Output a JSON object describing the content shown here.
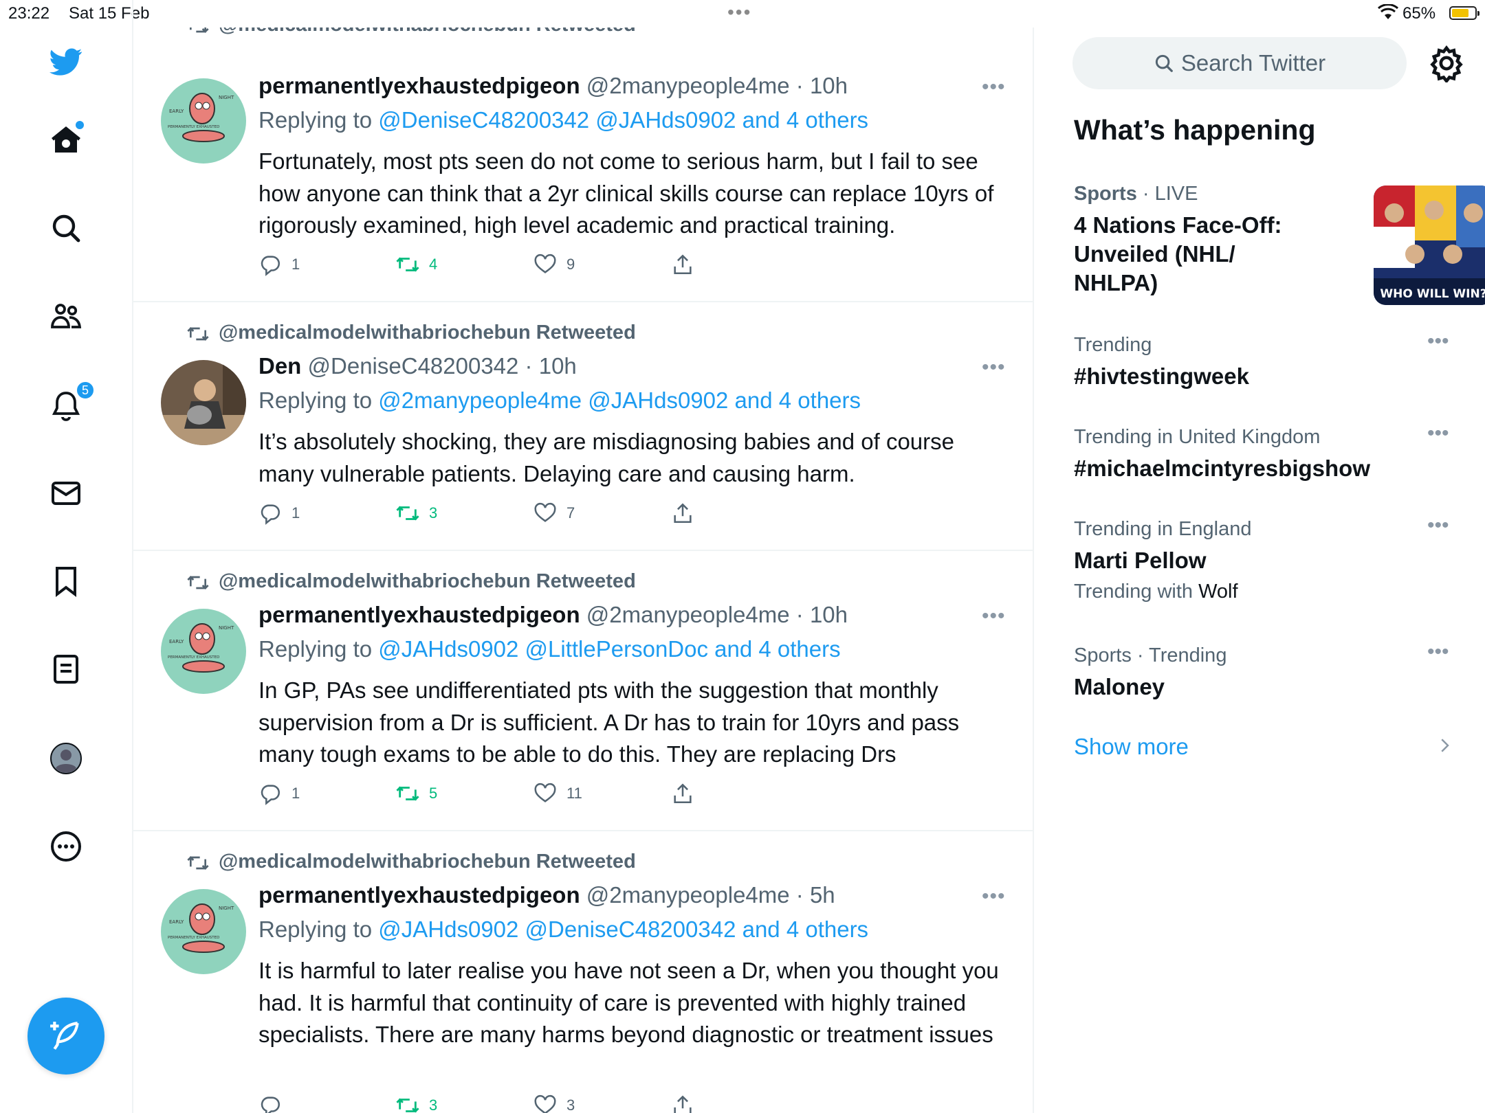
{
  "status_bar": {
    "time": "23:22",
    "date": "Sat 15 Feb",
    "battery": "65%"
  },
  "nav": {
    "notifications_badge": "5"
  },
  "top_partial_retweet": "@medicalmodelwithabriochebun Retweeted",
  "tweets": [
    {
      "name": "permanentlyexhaustedpigeon",
      "handle": "@2manypeople4me · 10h",
      "replying_prefix": "Replying to ",
      "replying_links": "@DeniseC48200342 @JAHds0902 and 4 others",
      "text": "Fortunately, most pts seen do not come to serious harm, but I fail to see how anyone can think that a 2yr clinical skills course can replace 10yrs of rigorously examined, high level academic and practical training.",
      "replies": "1",
      "retweets": "4",
      "likes": "9"
    },
    {
      "retweeted_by": "@medicalmodelwithabriochebun Retweeted",
      "name": "Den",
      "handle": "@DeniseC48200342 · 10h",
      "replying_prefix": "Replying to ",
      "replying_links": "@2manypeople4me @JAHds0902 and 4 others",
      "text": "It’s absolutely shocking, they are misdiagnosing babies and of course many vulnerable patients. Delaying care and causing harm.",
      "replies": "1",
      "retweets": "3",
      "likes": "7"
    },
    {
      "retweeted_by": "@medicalmodelwithabriochebun Retweeted",
      "name": "permanentlyexhaustedpigeon",
      "handle": "@2manypeople4me · 10h",
      "replying_prefix": "Replying to ",
      "replying_links": "@JAHds0902 @LittlePersonDoc and 4 others",
      "text": "In GP, PAs see undifferentiated pts with the suggestion that monthly supervision from a Dr is sufficient. A Dr has to train for 10yrs and pass many tough exams to be able to do this. They are replacing Drs",
      "replies": "1",
      "retweets": "5",
      "likes": "11"
    },
    {
      "retweeted_by": "@medicalmodelwithabriochebun Retweeted",
      "name": "permanentlyexhaustedpigeon",
      "handle": "@2manypeople4me · 5h",
      "replying_prefix": "Replying to ",
      "replying_links": "@JAHds0902 @DeniseC48200342 and 4 others",
      "text": "It is harmful to later realise you have not seen a Dr, when you thought you had. It is harmful that continuity of care is prevented with highly trained specialists. There are many harms beyond diagnostic or treatment issues",
      "replies": "",
      "retweets": "3",
      "likes": "3"
    }
  ],
  "right": {
    "search_placeholder": "Search Twitter",
    "title": "What’s happening",
    "trends": [
      {
        "context_a": "Sports",
        "context_b": " · LIVE",
        "title": "4 Nations Face-Off: Unveiled (NHL/ NHLPA)",
        "image_caption": "WHO WILL WIN?"
      },
      {
        "context": "Trending",
        "title": "#hivtestingweek"
      },
      {
        "context": "Trending in United Kingdom",
        "title": "#michaelmcintyresbigshow"
      },
      {
        "context": "Trending in England",
        "title": "Marti Pellow",
        "sub_prefix": "Trending with ",
        "sub_value": "Wolf"
      },
      {
        "context": "Sports · Trending",
        "title": "Maloney"
      }
    ],
    "show_more": "Show more"
  },
  "colors": {
    "accent": "#1d9bf0",
    "retweet": "#00ba7c",
    "secondary_text": "#536471",
    "border": "#eff3f4"
  }
}
